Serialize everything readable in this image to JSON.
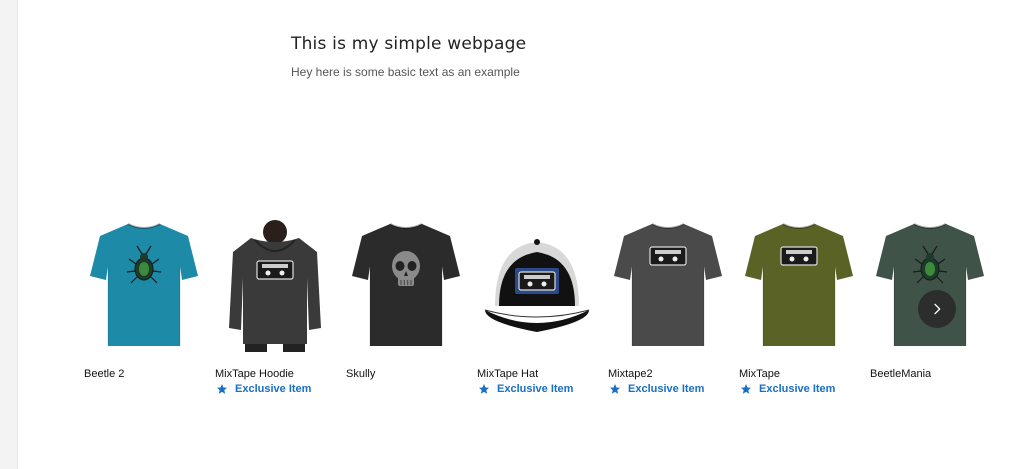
{
  "header": {
    "title": "This is my simple webpage",
    "subtitle": "Hey here is some basic text as an example"
  },
  "products": [
    {
      "name": "Beetle 2",
      "badge": "",
      "kind": "tshirt",
      "color": "#1d8aa8",
      "graphic": "beetle"
    },
    {
      "name": "MixTape Hoodie",
      "badge": "Exclusive Item",
      "kind": "hoodie",
      "color": "#3a3a3a",
      "graphic": "tape"
    },
    {
      "name": "Skully",
      "badge": "",
      "kind": "tshirt",
      "color": "#2b2b2b",
      "graphic": "skull"
    },
    {
      "name": "MixTape Hat",
      "badge": "Exclusive Item",
      "kind": "hat",
      "color": "#111111",
      "graphic": "tape"
    },
    {
      "name": "Mixtape2",
      "badge": "Exclusive Item",
      "kind": "tshirt",
      "color": "#4a4a4a",
      "graphic": "tape"
    },
    {
      "name": "MixTape",
      "badge": "Exclusive Item",
      "kind": "tshirt",
      "color": "#5a6225",
      "graphic": "tape"
    },
    {
      "name": "BeetleMania",
      "badge": "",
      "kind": "tshirt",
      "color": "#3f5348",
      "graphic": "beetle"
    }
  ],
  "colors": {
    "badge": "#1a6fc4",
    "next_button": "#282828"
  },
  "icons": {
    "badge": "star-icon",
    "next": "chevron-right-icon"
  }
}
